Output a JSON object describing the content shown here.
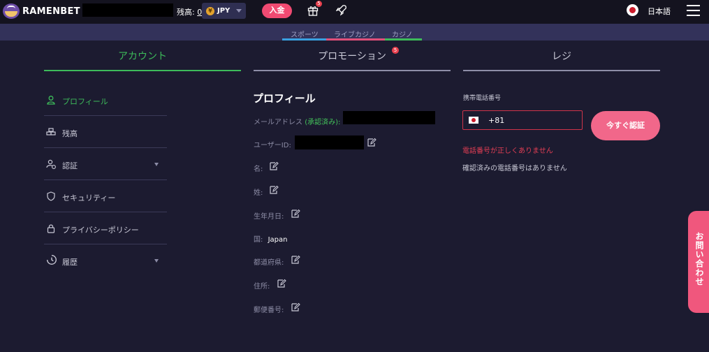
{
  "header": {
    "brand": "RAMENBET",
    "balance_label": "残高:",
    "balance_value": "0",
    "currency_symbol": "¥",
    "currency": "JPY",
    "deposit_label": "入金",
    "gift_badge": "5",
    "language": "日本語"
  },
  "subnav": {
    "tabs": [
      "スポーツ",
      "ライブカジノ",
      "カジノ"
    ],
    "underline_colors": [
      "#3aa0e0",
      "#e0507a",
      "#3dbb5a"
    ]
  },
  "tabs": {
    "account": "アカウント",
    "promotion": "プロモーション",
    "promotion_badge": "5",
    "cashier": "レジ"
  },
  "sidebar": {
    "items": [
      {
        "label": "プロフィール",
        "icon": "user-icon"
      },
      {
        "label": "残高",
        "icon": "coins-icon"
      },
      {
        "label": "認証",
        "icon": "user-check-icon"
      },
      {
        "label": "セキュリティー",
        "icon": "shield-icon"
      },
      {
        "label": "プライバシーポリシー",
        "icon": "lock-icon"
      },
      {
        "label": "履歴",
        "icon": "history-icon"
      }
    ]
  },
  "profile": {
    "title": "プロフィール",
    "email_label": "メールアドレス",
    "email_verified": "(承認済み):",
    "user_id_label": "ユーザーID:",
    "first_name_label": "名:",
    "last_name_label": "姓:",
    "birthdate_label": "生年月日:",
    "country_label": "国:",
    "country_value": "Japan",
    "prefecture_label": "都道府県:",
    "address_label": "住所:",
    "postal_label": "郵便番号:"
  },
  "phone": {
    "label": "携帯電話番号",
    "country_code": "+81",
    "send_button": "今すぐ認証",
    "error": "電話番号が正しくありません",
    "info": "確認済みの電話番号はありません"
  },
  "contact": {
    "label": "お問い合わせ"
  },
  "colors": {
    "accent_green": "#3dbb5a",
    "accent_pink": "#f04a72",
    "error_red": "#e33e54"
  }
}
